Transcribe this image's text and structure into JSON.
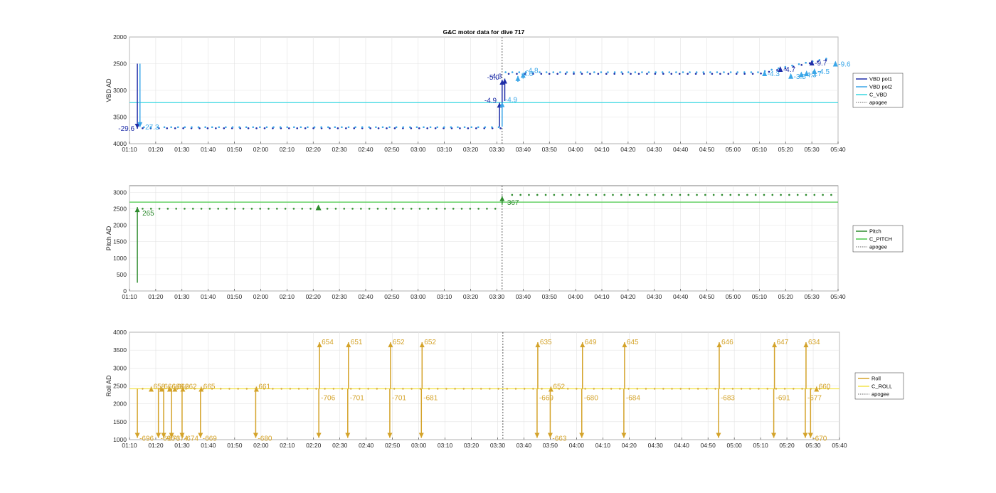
{
  "title": "G&C motor data for dive 717",
  "colors": {
    "vbd_pot1": "#1f2ea8",
    "vbd_pot2": "#3aa6e8",
    "c_vbd": "#35d6e0",
    "pitch": "#2e8b2e",
    "c_pitch": "#49c949",
    "roll": "#d4a32a",
    "c_roll": "#f2e34a",
    "apogee": "#333333"
  },
  "chart_data": [
    {
      "type": "scatter",
      "ylabel": "VBD AD",
      "ylim": [
        2000,
        4000
      ],
      "y_reversed": true,
      "y_ticks": [
        2000,
        2500,
        3000,
        3500,
        4000
      ],
      "x_range": [
        "01:10",
        "05:40"
      ],
      "x_ticks": [
        "01:10",
        "01:20",
        "01:30",
        "01:40",
        "01:50",
        "02:00",
        "02:10",
        "02:20",
        "02:30",
        "02:40",
        "02:50",
        "03:00",
        "03:10",
        "03:20",
        "03:30",
        "03:40",
        "03:50",
        "04:00",
        "04:10",
        "04:20",
        "04:30",
        "04:40",
        "04:50",
        "05:00",
        "05:10",
        "05:20",
        "05:30",
        "05:40"
      ],
      "grid": true,
      "legend_position": "outside-right",
      "legend": [
        "VBD pot1",
        "VBD pot2",
        "C_VBD",
        "apogee"
      ],
      "c_vbd_value": 3230,
      "apogee_x": "03:32",
      "arrows": [
        {
          "series": "VBD pot1",
          "x": "01:13",
          "y_from": 2500,
          "y_to": 3720,
          "label": "-29.6"
        },
        {
          "series": "VBD pot2",
          "x": "01:14",
          "y_from": 2500,
          "y_to": 3690,
          "label": "-27.3"
        },
        {
          "series": "VBD pot1",
          "x": "03:31",
          "y_from": 3680,
          "y_to": 3230,
          "label": "-4.9"
        },
        {
          "series": "VBD pot2",
          "x": "03:32",
          "y_from": 3680,
          "y_to": 3220,
          "label": "-4.9"
        },
        {
          "series": "VBD pot1",
          "x": "03:32",
          "y_from": 3230,
          "y_to": 2800,
          "label": "-5.0"
        },
        {
          "series": "VBD pot1",
          "x": "03:33",
          "y_from": 3200,
          "y_to": 2780,
          "label": "-4.3"
        },
        {
          "series": "VBD pot2",
          "x": "03:38",
          "y_from": 2840,
          "y_to": 2730,
          "label": "-4.6"
        },
        {
          "series": "VBD pot2",
          "x": "03:40",
          "y_from": 2780,
          "y_to": 2670,
          "label": "-4.8"
        }
      ],
      "end_labels": [
        {
          "series": "VBD pot2",
          "x": "05:12",
          "y": 2680,
          "label": "-4.3"
        },
        {
          "series": "VBD pot1",
          "x": "05:18",
          "y": 2600,
          "label": "-4.7"
        },
        {
          "series": "VBD pot2",
          "x": "05:22",
          "y": 2730,
          "label": "-3.5"
        },
        {
          "series": "VBD pot2",
          "x": "05:26",
          "y": 2700,
          "label": "-4.3"
        },
        {
          "series": "VBD pot2",
          "x": "05:28",
          "y": 2680,
          "label": "-3.7"
        },
        {
          "series": "VBD pot1",
          "x": "05:30",
          "y": 2480,
          "label": "-9.7"
        },
        {
          "series": "VBD pot2",
          "x": "05:31",
          "y": 2640,
          "label": "-4.5"
        },
        {
          "series": "VBD pot2",
          "x": "05:39",
          "y": 2500,
          "label": "-9.6"
        }
      ],
      "series": [
        {
          "name": "VBD pot1",
          "x_range": [
            "01:15",
            "05:38"
          ],
          "values_start": 3710,
          "values_mid": 2690,
          "values_end": 2400
        },
        {
          "name": "VBD pot2",
          "x_range": [
            "01:15",
            "05:38"
          ],
          "values_start": 3690,
          "values_mid": 2660,
          "values_end": 2380
        }
      ]
    },
    {
      "type": "scatter",
      "ylabel": "Pitch AD",
      "ylim": [
        0,
        3200
      ],
      "y_ticks": [
        0,
        500,
        1000,
        1500,
        2000,
        2500,
        3000
      ],
      "x_range": [
        "01:10",
        "05:40"
      ],
      "x_ticks": [
        "01:10",
        "01:20",
        "01:30",
        "01:40",
        "01:50",
        "02:00",
        "02:10",
        "02:20",
        "02:30",
        "02:40",
        "02:50",
        "03:00",
        "03:10",
        "03:20",
        "03:30",
        "03:40",
        "03:50",
        "04:00",
        "04:10",
        "04:20",
        "04:30",
        "04:40",
        "04:50",
        "05:00",
        "05:10",
        "05:20",
        "05:30",
        "05:40"
      ],
      "grid": true,
      "legend_position": "outside-right",
      "legend": [
        "Pitch",
        "C_PITCH",
        "apogee"
      ],
      "c_pitch_value": 2700,
      "apogee_x": "03:32",
      "arrows": [
        {
          "x": "01:13",
          "y_from": 250,
          "y_to": 2550,
          "label": "265"
        },
        {
          "x": "03:32",
          "y_from": 2620,
          "y_to": 2880,
          "label": "367"
        }
      ],
      "series": [
        {
          "name": "Pitch",
          "before_apogee": 2500,
          "after_apogee": 2920
        }
      ]
    },
    {
      "type": "scatter",
      "ylabel": "Roll AD",
      "ylim": [
        1000,
        4000
      ],
      "y_ticks": [
        1000,
        1500,
        2000,
        2500,
        3000,
        3500,
        4000
      ],
      "x_range": [
        "01:10",
        "05:40"
      ],
      "x_ticks": [
        "01:10",
        "01:20",
        "01:30",
        "01:40",
        "01:50",
        "02:00",
        "02:10",
        "02:20",
        "02:30",
        "02:40",
        "02:50",
        "03:00",
        "03:10",
        "03:20",
        "03:30",
        "03:40",
        "03:50",
        "04:00",
        "04:10",
        "04:20",
        "04:30",
        "04:40",
        "04:50",
        "05:00",
        "05:10",
        "05:20",
        "05:30",
        "05:40"
      ],
      "grid": true,
      "legend_position": "outside-right",
      "legend": [
        "Roll",
        "C_ROLL",
        "apogee"
      ],
      "c_roll_value": 2420,
      "apogee_x": "03:32",
      "down_arrows": [
        {
          "x": "01:13",
          "label": "-696"
        },
        {
          "x": "01:21",
          "label": "-696"
        },
        {
          "x": "01:23",
          "label": "-673"
        },
        {
          "x": "01:26",
          "label": "-674"
        },
        {
          "x": "01:30",
          "label": "-674"
        },
        {
          "x": "01:37",
          "label": "-669"
        },
        {
          "x": "01:58",
          "label": "-680"
        },
        {
          "x": "02:22",
          "label": "-706"
        },
        {
          "x": "02:33",
          "label": "-701"
        },
        {
          "x": "02:49",
          "label": "-701"
        },
        {
          "x": "03:01",
          "label": "-681"
        },
        {
          "x": "03:45",
          "label": "-669"
        },
        {
          "x": "03:50",
          "label": "-663"
        },
        {
          "x": "04:02",
          "label": "-680"
        },
        {
          "x": "04:18",
          "label": "-684"
        },
        {
          "x": "04:54",
          "label": "-683"
        },
        {
          "x": "05:15",
          "label": "-691"
        },
        {
          "x": "05:27",
          "label": "-677"
        },
        {
          "x": "05:29",
          "label": "-670"
        }
      ],
      "up_arrows": [
        {
          "x": "01:18",
          "label": "658"
        },
        {
          "x": "01:22",
          "label": "666"
        },
        {
          "x": "01:25",
          "label": "668"
        },
        {
          "x": "01:27",
          "label": "662"
        },
        {
          "x": "01:30",
          "label": "662"
        },
        {
          "x": "01:37",
          "label": "665"
        },
        {
          "x": "01:58",
          "label": "661"
        },
        {
          "x": "02:22",
          "label": "654"
        },
        {
          "x": "02:33",
          "label": "651"
        },
        {
          "x": "02:49",
          "label": "652"
        },
        {
          "x": "03:01",
          "label": "652"
        },
        {
          "x": "03:45",
          "label": "635"
        },
        {
          "x": "03:50",
          "label": "652"
        },
        {
          "x": "04:02",
          "label": "649"
        },
        {
          "x": "04:18",
          "label": "645"
        },
        {
          "x": "04:54",
          "label": "646"
        },
        {
          "x": "05:15",
          "label": "647"
        },
        {
          "x": "05:27",
          "label": "634"
        },
        {
          "x": "05:31",
          "label": "660"
        }
      ],
      "series": [
        {
          "name": "Roll",
          "baseline": 2420
        }
      ]
    }
  ]
}
